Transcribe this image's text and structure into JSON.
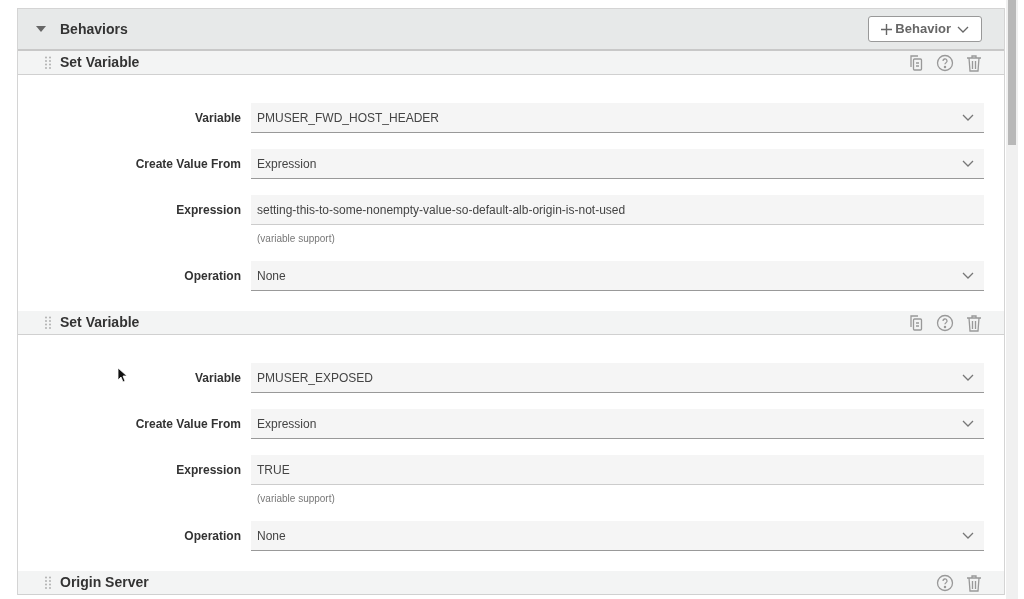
{
  "panel": {
    "title": "Behaviors",
    "expanded": true,
    "add_button": "Behavior"
  },
  "behaviors": [
    {
      "title": "Set Variable",
      "fields": [
        {
          "kind": "select",
          "label": "Variable",
          "value": "PMUSER_FWD_HOST_HEADER"
        },
        {
          "kind": "select",
          "label": "Create Value From",
          "value": "Expression"
        },
        {
          "kind": "text",
          "label": "Expression",
          "value": "setting-this-to-some-nonempty-value-so-default-alb-origin-is-not-used",
          "hint": "(variable support)"
        },
        {
          "kind": "select",
          "label": "Operation",
          "value": "None"
        }
      ]
    },
    {
      "title": "Set Variable",
      "fields": [
        {
          "kind": "select",
          "label": "Variable",
          "value": "PMUSER_EXPOSED"
        },
        {
          "kind": "select",
          "label": "Create Value From",
          "value": "Expression"
        },
        {
          "kind": "text",
          "label": "Expression",
          "value": "TRUE",
          "hint": "(variable support)"
        },
        {
          "kind": "select",
          "label": "Operation",
          "value": "None"
        }
      ]
    }
  ],
  "next_section": {
    "title": "Origin Server"
  }
}
